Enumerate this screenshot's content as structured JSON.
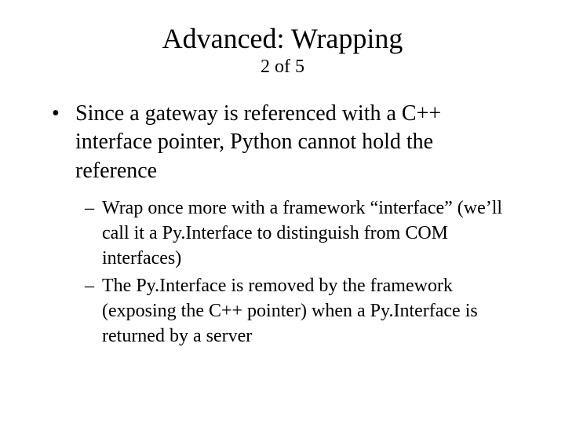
{
  "title": "Advanced: Wrapping",
  "subtitle": "2 of 5",
  "main_bullet": "Since a gateway is referenced with a C++ interface pointer, Python cannot hold the reference",
  "sub_bullets": [
    "Wrap once more with a framework “interface” (we’ll call it a Py.Interface to distinguish from COM interfaces)",
    "The Py.Interface is removed by the framework (exposing the C++ pointer) when a Py.Interface is returned by a server"
  ]
}
